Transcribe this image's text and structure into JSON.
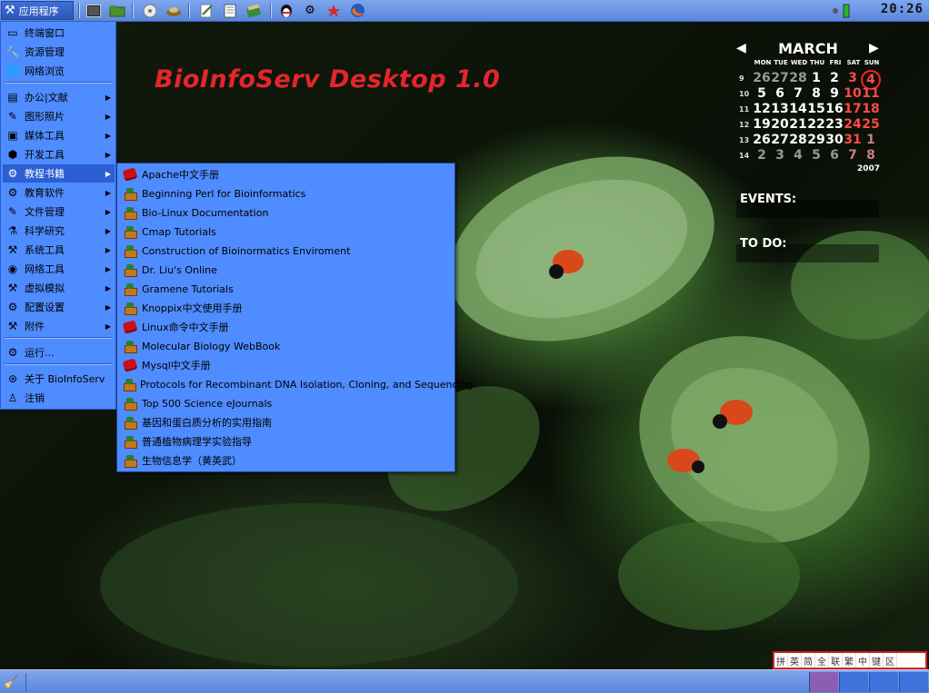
{
  "top_panel": {
    "app_menu_label": "应用程序",
    "launchers": [
      "terminal",
      "file-manager",
      "cd-player",
      "package",
      "text-editor",
      "document-viewer",
      "books",
      "qq-penguin",
      "gear",
      "star-tool",
      "firefox"
    ],
    "clock": "20:26"
  },
  "desktop": {
    "title": "BioInfoServ Desktop 1.0"
  },
  "app_menu": {
    "items": [
      {
        "label": "终端窗口",
        "icon": "terminal-icon",
        "submenu": false
      },
      {
        "label": "资源管理",
        "icon": "folder-icon",
        "submenu": false
      },
      {
        "label": "网络浏览",
        "icon": "globe-icon",
        "submenu": false
      },
      {
        "label": "办公|文献",
        "icon": "office-icon",
        "submenu": true
      },
      {
        "label": "图形照片",
        "icon": "graphics-icon",
        "submenu": true
      },
      {
        "label": "媒体工具",
        "icon": "media-icon",
        "submenu": true
      },
      {
        "label": "开发工具",
        "icon": "dev-tools-icon",
        "submenu": true
      },
      {
        "label": "教程书籍",
        "icon": "tutorial-books-icon",
        "submenu": true
      },
      {
        "label": "教育软件",
        "icon": "education-icon",
        "submenu": true
      },
      {
        "label": "文件管理",
        "icon": "file-manager-icon",
        "submenu": true
      },
      {
        "label": "科学研究",
        "icon": "science-icon",
        "submenu": true
      },
      {
        "label": "系统工具",
        "icon": "system-tools-icon",
        "submenu": true
      },
      {
        "label": "网络工具",
        "icon": "network-icon",
        "submenu": true
      },
      {
        "label": "虚拟模拟",
        "icon": "virtual-icon",
        "submenu": true
      },
      {
        "label": "配置设置",
        "icon": "settings-icon",
        "submenu": true
      },
      {
        "label": "附件",
        "icon": "accessories-icon",
        "submenu": true
      },
      {
        "label": "运行...",
        "icon": "run-icon",
        "submenu": false
      },
      {
        "label": "关于 BioInfoServ",
        "icon": "lifebuoy-icon",
        "submenu": false
      },
      {
        "label": "注销",
        "icon": "logout-icon",
        "submenu": false
      }
    ]
  },
  "submenu": {
    "items": [
      {
        "label": "Apache中文手册",
        "icon": "pdf-book-icon"
      },
      {
        "label": "Beginning Perl for Bioinformatics",
        "icon": "web-book-icon"
      },
      {
        "label": "Bio-Linux Documentation",
        "icon": "web-book-icon"
      },
      {
        "label": "Cmap Tutorials",
        "icon": "web-book-icon"
      },
      {
        "label": "Construction of Bioinormatics Enviroment",
        "icon": "web-book-icon"
      },
      {
        "label": "Dr. Liu's Online",
        "icon": "web-book-icon"
      },
      {
        "label": "Gramene Tutorials",
        "icon": "web-book-icon"
      },
      {
        "label": "Knoppix中文使用手册",
        "icon": "web-book-icon"
      },
      {
        "label": "Linux命令中文手册",
        "icon": "pdf-book-icon"
      },
      {
        "label": "Molecular Biology WebBook",
        "icon": "web-book-icon"
      },
      {
        "label": "Mysql中文手册",
        "icon": "pdf-book-icon"
      },
      {
        "label": "Protocols for Recombinant DNA Isolation, Cloning, and Sequencing",
        "icon": "web-book-icon"
      },
      {
        "label": "Top 500 Science eJournals",
        "icon": "web-book-icon"
      },
      {
        "label": "基因和蛋白质分析的实用指南",
        "icon": "web-book-icon"
      },
      {
        "label": "普通植物病理学实验指导",
        "icon": "web-book-icon"
      },
      {
        "label": "生物信息学（黄英武）",
        "icon": "web-book-icon"
      }
    ]
  },
  "calendar": {
    "month": "MARCH",
    "year": "2007",
    "days_of_week": [
      "MON",
      "TUE",
      "WED",
      "THU",
      "FRI",
      "SAT",
      "SUN"
    ],
    "weeks": [
      {
        "num": "9",
        "days": [
          "26",
          "27",
          "28",
          "1",
          "2",
          "3",
          "4"
        ]
      },
      {
        "num": "10",
        "days": [
          "5",
          "6",
          "7",
          "8",
          "9",
          "10",
          "11"
        ]
      },
      {
        "num": "11",
        "days": [
          "12",
          "13",
          "14",
          "15",
          "16",
          "17",
          "18"
        ]
      },
      {
        "num": "12",
        "days": [
          "19",
          "20",
          "21",
          "22",
          "23",
          "24",
          "25"
        ]
      },
      {
        "num": "13",
        "days": [
          "26",
          "27",
          "28",
          "29",
          "30",
          "31",
          "1"
        ]
      },
      {
        "num": "14",
        "days": [
          "2",
          "3",
          "4",
          "5",
          "6",
          "7",
          "8"
        ]
      }
    ],
    "today": "4",
    "events_label": "EVENTS:",
    "todo_label": "TO DO:"
  },
  "ime": [
    "拼",
    "英",
    "简",
    "全",
    "联",
    "繁",
    "中",
    "键",
    "区"
  ]
}
